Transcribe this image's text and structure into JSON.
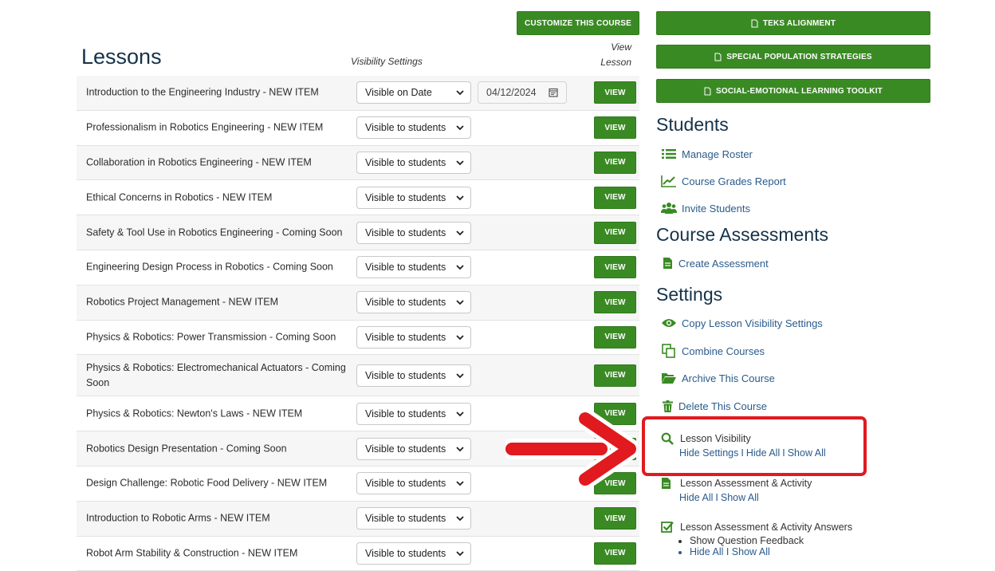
{
  "header": {
    "customize_label": "CUSTOMIZE THIS COURSE",
    "lessons_title": "Lessons",
    "visibility_header": "Visibility Settings",
    "view_header": "View Lesson"
  },
  "lessons": [
    {
      "title": "Introduction to the Engineering Industry - NEW ITEM",
      "visibility": "Visible on Date",
      "date": "04/12/2024",
      "view": "VIEW"
    },
    {
      "title": "Professionalism in Robotics Engineering - NEW ITEM",
      "visibility": "Visible to students",
      "view": "VIEW"
    },
    {
      "title": "Collaboration in Robotics Engineering - NEW ITEM",
      "visibility": "Visible to students",
      "view": "VIEW"
    },
    {
      "title": "Ethical Concerns in Robotics - NEW ITEM",
      "visibility": "Visible to students",
      "view": "VIEW"
    },
    {
      "title": "Safety & Tool Use in Robotics Engineering - Coming Soon",
      "visibility": "Visible to students",
      "view": "VIEW"
    },
    {
      "title": "Engineering Design Process in Robotics - Coming Soon",
      "visibility": "Visible to students",
      "view": "VIEW"
    },
    {
      "title": "Robotics Project Management - NEW ITEM",
      "visibility": "Visible to students",
      "view": "VIEW"
    },
    {
      "title": "Physics & Robotics: Power Transmission - Coming Soon",
      "visibility": "Visible to students",
      "view": "VIEW"
    },
    {
      "title": "Physics & Robotics: Electromechanical Actuators - Coming Soon",
      "visibility": "Visible to students",
      "view": "VIEW"
    },
    {
      "title": "Physics & Robotics: Newton's Laws - NEW ITEM",
      "visibility": "Visible to students",
      "view": "VIEW"
    },
    {
      "title": "Robotics Design Presentation - Coming Soon",
      "visibility": "Visible to students",
      "view": "VIEW"
    },
    {
      "title": "Design Challenge: Robotic Food Delivery - NEW ITEM",
      "visibility": "Visible to students",
      "view": "VIEW"
    },
    {
      "title": "Introduction to Robotic Arms - NEW ITEM",
      "visibility": "Visible to students",
      "view": "VIEW"
    },
    {
      "title": "Robot Arm Stability & Construction - NEW ITEM",
      "visibility": "Visible to students",
      "view": "VIEW"
    }
  ],
  "sidebar": {
    "buttons": {
      "teks": "TEKS ALIGNMENT",
      "special": "SPECIAL POPULATION STRATEGIES",
      "sel": "SOCIAL-EMOTIONAL LEARNING TOOLKIT"
    },
    "students_heading": "Students",
    "manage_roster": "Manage Roster",
    "grades_report": "Course Grades Report",
    "invite_students": "Invite Students",
    "assessments_heading": "Course Assessments",
    "create_assessment": "Create Assessment",
    "settings_heading": "Settings",
    "copy_visibility": "Copy Lesson Visibility Settings",
    "combine_courses": "Combine Courses",
    "archive_course": "Archive This Course",
    "delete_course": "Delete This Course",
    "lesson_visibility": {
      "label": "Lesson Visibility",
      "hide_settings": "Hide Settings",
      "hide_all": "Hide All",
      "show_all": "Show All",
      "separator": "I"
    },
    "assessment_activity": {
      "label": "Lesson Assessment & Activity",
      "hide_all": "Hide All",
      "show_all": "Show All",
      "separator": "I"
    },
    "answers": {
      "label": "Lesson Assessment & Activity Answers",
      "bullet_1": "Show Question Feedback",
      "bullet_2": "Hide All I Show All"
    }
  },
  "colors": {
    "button_green": "#3a8a24",
    "link_blue": "#2a5b8c",
    "heading": "#15324a",
    "highlight_red": "#e11a1f"
  }
}
